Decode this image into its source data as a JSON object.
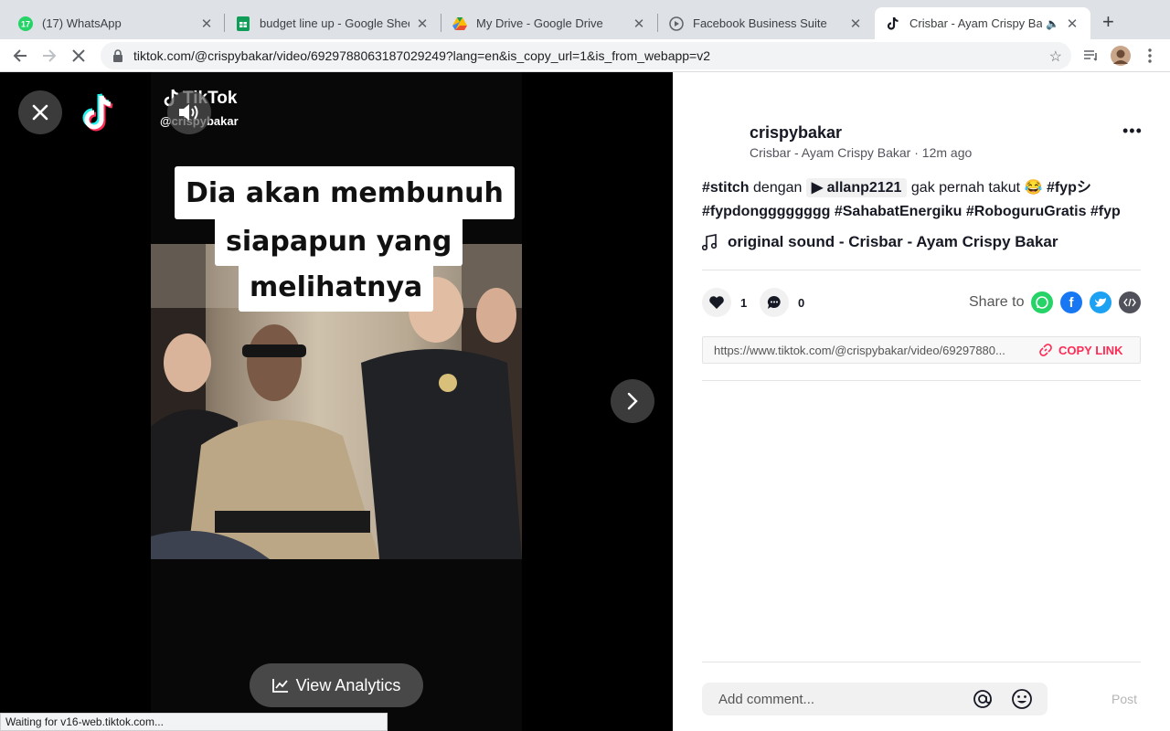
{
  "browser": {
    "tabs": [
      {
        "title": "(17) WhatsApp",
        "icon": "whatsapp-icon",
        "badge": "17"
      },
      {
        "title": "budget line up - Google Sheets",
        "icon": "sheets-icon"
      },
      {
        "title": "My Drive - Google Drive",
        "icon": "drive-icon"
      },
      {
        "title": "Facebook Business Suite",
        "icon": "business-suite-icon"
      },
      {
        "title": "Crisbar - Ayam Crispy Bakar",
        "icon": "tiktok-icon",
        "active": true
      }
    ],
    "url": "tiktok.com/@crispybakar/video/6929788063187029249?lang=en&is_copy_url=1&is_from_webapp=v2",
    "status_text": "Waiting for v16-web.tiktok.com..."
  },
  "player": {
    "watermark_brand": "TikTok",
    "watermark_handle": "@crispybakar",
    "captions": [
      "Dia akan membunuh",
      "siapapun yang",
      "melihatnya"
    ],
    "analytics_label": "View Analytics"
  },
  "post": {
    "author_name": "crispybakar",
    "author_sub": "Crisbar - Ayam Crispy Bakar · 12m ago",
    "desc": {
      "tag_stitch": "#stitch",
      "word_dengan": "dengan",
      "mention": "allanp2121",
      "text": "gak pernah takut",
      "emoji": "😂",
      "tag_fyp": "#fypシ",
      "tags_line2": "#fypdongggggggg #SahabatEnergiku #RoboguruGratis #fyp"
    },
    "music": "original sound - Crisbar - Ayam Crispy Bakar",
    "likes": "1",
    "comments": "0",
    "share_label": "Share to",
    "link_url": "https://www.tiktok.com/@crispybakar/video/69297880...",
    "copy_link_label": "COPY LINK",
    "comment_placeholder": "Add comment...",
    "post_label": "Post"
  },
  "colors": {
    "accent": "#fe2c55",
    "whatsapp": "#25d366",
    "facebook": "#1877f2",
    "twitter": "#1da1f2",
    "embed": "#161823"
  }
}
